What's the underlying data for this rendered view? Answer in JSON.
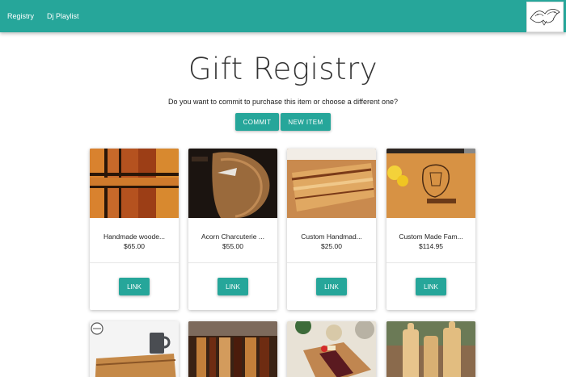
{
  "nav": {
    "registry": "Registry",
    "playlist": "Dj Playlist"
  },
  "page": {
    "title": "Gift Registry",
    "question": "Do you want to commit to purchase this item or choose a different one?",
    "commit": "COMMIT",
    "new_item": "NEW ITEM"
  },
  "items": [
    {
      "name": "Handmade woode...",
      "price": "$65.00",
      "link": "LINK"
    },
    {
      "name": "Acorn Charcuterie ...",
      "price": "$55.00",
      "link": "LINK"
    },
    {
      "name": "Custom Handmad...",
      "price": "$25.00",
      "link": "LINK"
    },
    {
      "name": "Custom Made Fam...",
      "price": "$114.95",
      "link": "LINK"
    }
  ],
  "colors": {
    "accent": "#26a69a"
  }
}
